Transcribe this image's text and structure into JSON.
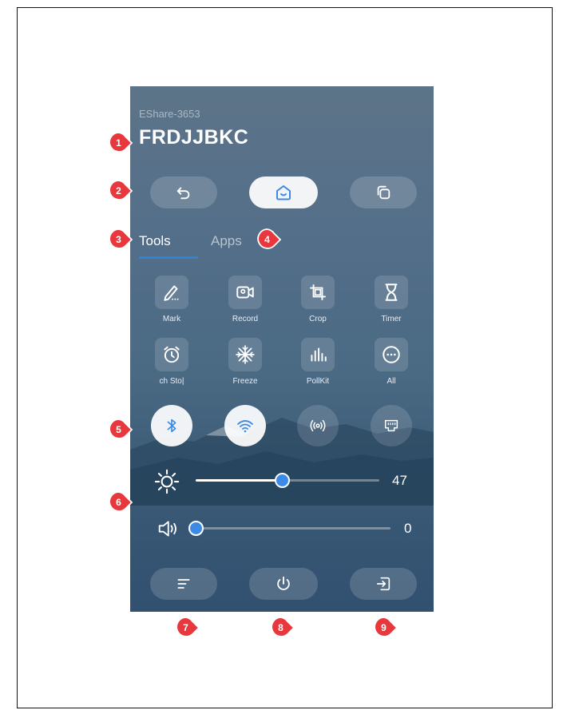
{
  "device": {
    "name": "EShare-3653",
    "code": "FRDJJBKC"
  },
  "nav": {
    "back_icon": "back-arrow-icon",
    "home_icon": "home-icon",
    "multitask_icon": "multitask-icon"
  },
  "tabs": [
    {
      "label": "Tools",
      "active": true
    },
    {
      "label": "Apps",
      "active": false
    }
  ],
  "tools": [
    {
      "label": "Mark",
      "icon": "pen-icon"
    },
    {
      "label": "Record",
      "icon": "camera-record-icon"
    },
    {
      "label": "Crop",
      "icon": "crop-icon"
    },
    {
      "label": "Timer",
      "icon": "hourglass-icon"
    },
    {
      "label": "ch   Sto|",
      "icon": "alarm-clock-icon"
    },
    {
      "label": "Freeze",
      "icon": "snowflake-icon"
    },
    {
      "label": "PollKit",
      "icon": "bar-chart-icon"
    },
    {
      "label": "All",
      "icon": "more-dots-icon"
    }
  ],
  "toggles": [
    {
      "icon": "bluetooth-icon",
      "on": true
    },
    {
      "icon": "wifi-icon",
      "on": true
    },
    {
      "icon": "hotspot-icon",
      "on": false
    },
    {
      "icon": "ethernet-icon",
      "on": false
    }
  ],
  "brightness": {
    "value": "47",
    "level": 47,
    "icon": "sun-icon"
  },
  "volume": {
    "value": "0",
    "level": 0,
    "icon": "speaker-icon"
  },
  "bottom": {
    "menu_icon": "menu-lines-icon",
    "power_icon": "power-icon",
    "exit_icon": "exit-icon"
  },
  "badges": [
    "1",
    "2",
    "3",
    "4",
    "5",
    "6",
    "7",
    "8",
    "9"
  ],
  "colors": {
    "badge": "#e8383e",
    "accent": "#3d8ae6",
    "tab_underline": "#2f86d9"
  }
}
